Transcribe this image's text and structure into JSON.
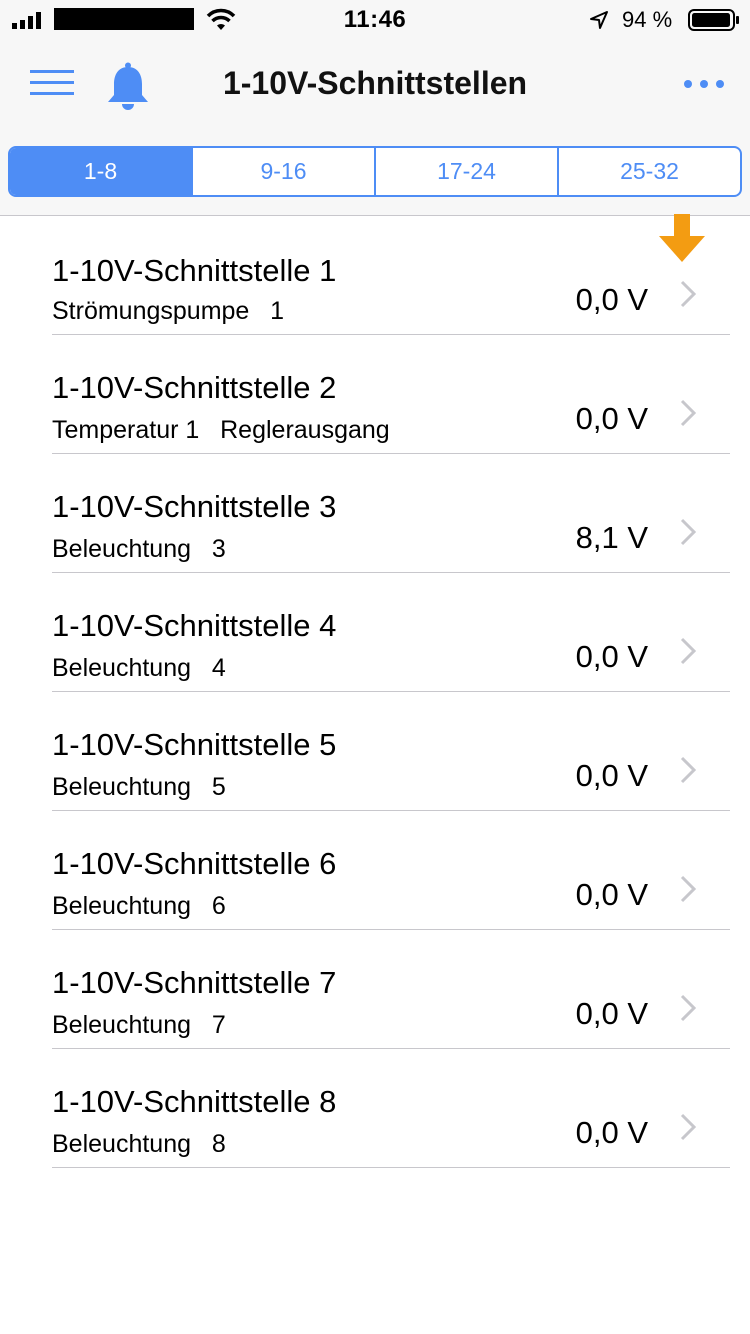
{
  "status_bar": {
    "time": "11:46",
    "battery": "94 %"
  },
  "nav": {
    "title": "1-10V-Schnittstellen",
    "menu_icon": "hamburger-menu-icon",
    "bell_icon": "bell-icon",
    "more_icon": "more-dots-icon"
  },
  "tabs": [
    {
      "label": "1-8",
      "active": true
    },
    {
      "label": "9-16",
      "active": false
    },
    {
      "label": "17-24",
      "active": false
    },
    {
      "label": "25-32",
      "active": false
    }
  ],
  "rows": [
    {
      "title": "1-10V-Schnittstelle 1",
      "subtitle": "Strömungspumpe   1",
      "value": "0,0 V"
    },
    {
      "title": "1-10V-Schnittstelle 2",
      "subtitle": "Temperatur 1   Reglerausgang",
      "value": "0,0 V"
    },
    {
      "title": "1-10V-Schnittstelle 3",
      "subtitle": "Beleuchtung   3",
      "value": "8,1 V"
    },
    {
      "title": "1-10V-Schnittstelle 4",
      "subtitle": "Beleuchtung   4",
      "value": "0,0 V"
    },
    {
      "title": "1-10V-Schnittstelle 5",
      "subtitle": "Beleuchtung   5",
      "value": "0,0 V"
    },
    {
      "title": "1-10V-Schnittstelle 6",
      "subtitle": "Beleuchtung   6",
      "value": "0,0 V"
    },
    {
      "title": "1-10V-Schnittstelle 7",
      "subtitle": "Beleuchtung   7",
      "value": "0,0 V"
    },
    {
      "title": "1-10V-Schnittstelle 8",
      "subtitle": "Beleuchtung   8",
      "value": "0,0 V"
    }
  ],
  "colors": {
    "accent": "#4e8df5",
    "download_arrow": "#f39c12",
    "chevron": "#c7c7cc"
  }
}
